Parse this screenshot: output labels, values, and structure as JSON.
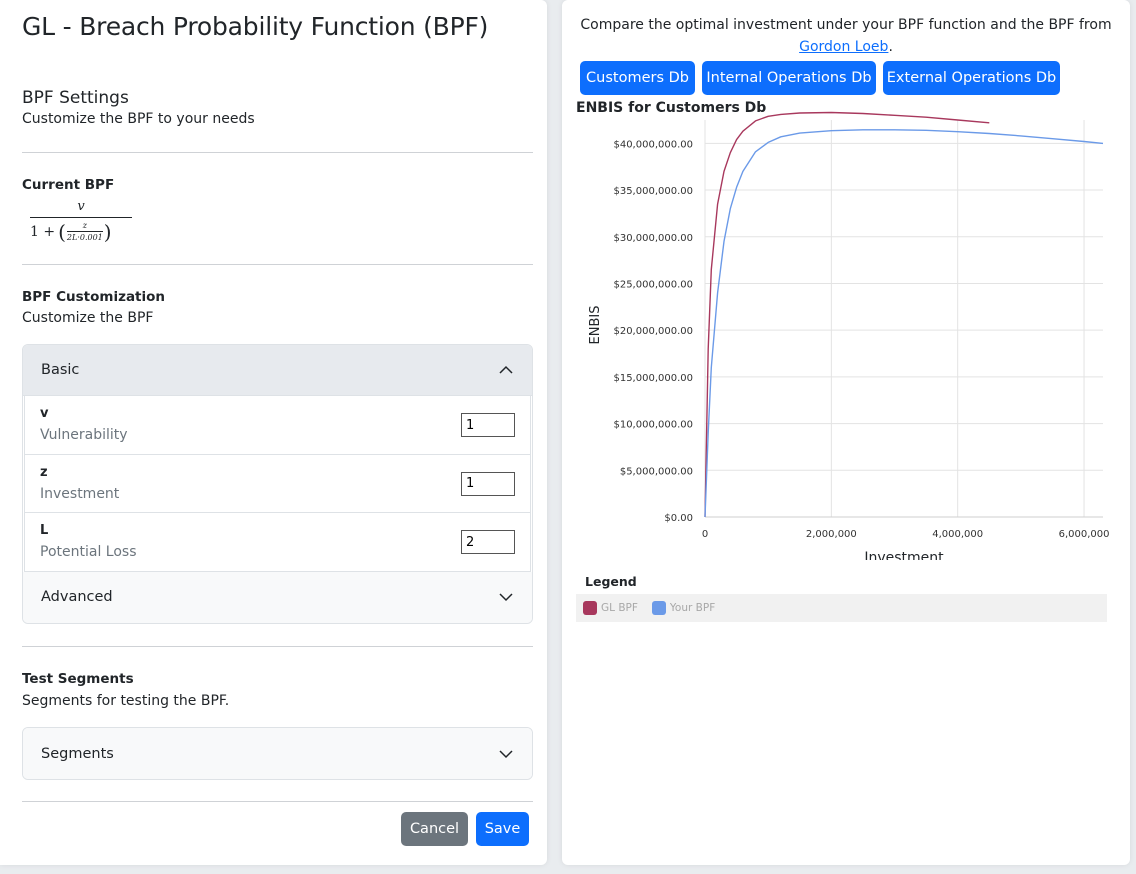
{
  "left": {
    "title": "GL - Breach Probability Function (BPF)",
    "settings": {
      "heading": "BPF Settings",
      "subtitle": "Customize the BPF to your needs"
    },
    "current": {
      "heading": "Current BPF",
      "formula": {
        "numerator": "v",
        "denominator_prefix": "1 +",
        "inner_numerator": "z",
        "inner_denominator": "2L·0.001"
      }
    },
    "customization": {
      "heading": "BPF Customization",
      "subtitle": "Customize the BPF",
      "basic_label": "Basic",
      "advanced_label": "Advanced",
      "fields": [
        {
          "label": "v",
          "description": "Vulnerability",
          "value": "1"
        },
        {
          "label": "z",
          "description": "Investment",
          "value": "1"
        },
        {
          "label": "L",
          "description": "Potential Loss",
          "value": "2"
        }
      ]
    },
    "segments": {
      "heading": "Test Segments",
      "subtitle": "Segments for testing the BPF.",
      "accordion_label": "Segments"
    },
    "actions": {
      "cancel": "Cancel",
      "save": "Save"
    }
  },
  "right": {
    "compare_text": "Compare the optimal investment under your BPF function and the BPF from",
    "link_text": "Gordon Loeb",
    "link_suffix": ".",
    "tabs": [
      "Customers Db",
      "Internal Operations Db",
      "External Operations Db"
    ],
    "chart_heading": "ENBIS for Customers Db",
    "legend_title": "Legend"
  },
  "chart_data": {
    "type": "line",
    "xlabel": "Investment",
    "ylabel": "ENBIS",
    "xlim": [
      0,
      6300000
    ],
    "ylim": [
      0,
      42500000
    ],
    "grid": true,
    "x_ticks": [
      0,
      2000000,
      4000000,
      6000000
    ],
    "x_tick_labels": [
      "0",
      "2,000,000",
      "4,000,000",
      "6,000,000"
    ],
    "y_ticks": [
      0,
      5000000,
      10000000,
      15000000,
      20000000,
      25000000,
      30000000,
      35000000,
      40000000
    ],
    "y_tick_labels": [
      "$0.00",
      "$5,000,000.00",
      "$10,000,000.00",
      "$15,000,000.00",
      "$20,000,000.00",
      "$25,000,000.00",
      "$30,000,000.00",
      "$35,000,000.00",
      "$40,000,000.00"
    ],
    "series": [
      {
        "name": "GL BPF",
        "color": "#a8385d",
        "x": [
          0,
          50000,
          100000,
          200000,
          300000,
          400000,
          500000,
          600000,
          800000,
          1000000,
          1200000,
          1500000,
          2000000,
          2500000,
          3000000,
          3500000,
          4000000,
          4500000
        ],
        "y": [
          0,
          18000000,
          26500000,
          33500000,
          37000000,
          39000000,
          40400000,
          41300000,
          42400000,
          42900000,
          43100000,
          43250000,
          43300000,
          43200000,
          43000000,
          42800000,
          42500000,
          42200000
        ]
      },
      {
        "name": "Your BPF",
        "color": "#6b9ae8",
        "x": [
          0,
          50000,
          100000,
          200000,
          300000,
          400000,
          500000,
          600000,
          800000,
          1000000,
          1200000,
          1500000,
          2000000,
          2500000,
          3000000,
          3500000,
          4000000,
          4500000,
          5000000,
          5500000,
          6000000,
          6300000
        ],
        "y": [
          0,
          9000000,
          16000000,
          24000000,
          29500000,
          33000000,
          35300000,
          37000000,
          39100000,
          40100000,
          40700000,
          41100000,
          41350000,
          41450000,
          41450000,
          41400000,
          41250000,
          41050000,
          40800000,
          40500000,
          40200000,
          40000000
        ]
      }
    ]
  }
}
